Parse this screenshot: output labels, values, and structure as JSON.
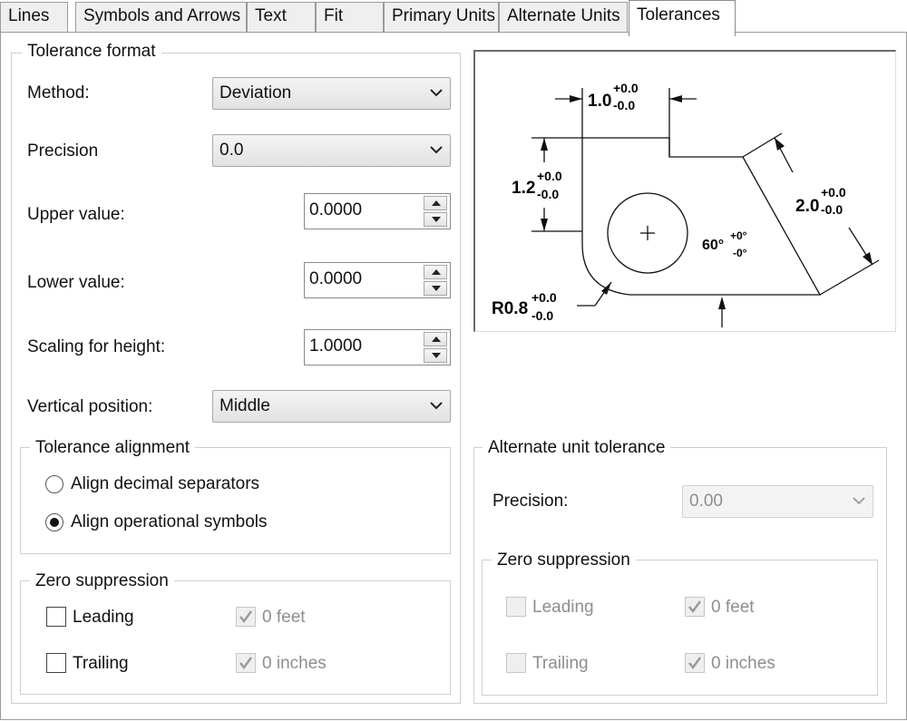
{
  "tabs": [
    {
      "label": "Lines"
    },
    {
      "label": "Symbols and Arrows"
    },
    {
      "label": "Text"
    },
    {
      "label": "Fit"
    },
    {
      "label": "Primary Units"
    },
    {
      "label": "Alternate Units"
    },
    {
      "label": "Tolerances",
      "active": true
    }
  ],
  "tolerance_format": {
    "title": "Tolerance format",
    "method_label": "Method:",
    "method_value": "Deviation",
    "precision_label": "Precision",
    "precision_value": "0.0",
    "upper_label": "Upper value:",
    "upper_value": "0.0000",
    "lower_label": "Lower value:",
    "lower_value": "0.0000",
    "scaling_label": "Scaling for height:",
    "scaling_value": "1.0000",
    "vertical_label": "Vertical position:",
    "vertical_value": "Middle"
  },
  "alignment": {
    "title": "Tolerance alignment",
    "option1": "Align decimal separators",
    "option2": "Align operational symbols",
    "selected": "option2"
  },
  "zero_suppression": {
    "title": "Zero suppression",
    "leading": "Leading",
    "trailing": "Trailing",
    "feet": "0 feet",
    "inches": "0 inches",
    "leading_checked": false,
    "trailing_checked": false,
    "feet_checked": true,
    "inches_checked": true
  },
  "alternate": {
    "title": "Alternate unit tolerance",
    "precision_label": "Precision:",
    "precision_value": "0.00",
    "zero_title": "Zero suppression",
    "leading": "Leading",
    "trailing": "Trailing",
    "feet": "0 feet",
    "inches": "0 inches",
    "feet_checked": true,
    "inches_checked": true
  },
  "preview": {
    "dim_top": "1.0",
    "dim_left": "1.2",
    "dim_right": "2.0",
    "dim_radius": "R0.8",
    "dim_angle": "60°",
    "tol_plus": "+0.0",
    "tol_minus": "-0.0",
    "angle_plus": "+0°",
    "angle_minus": "-0°"
  },
  "colors": {
    "tab_inactive": "#efefef",
    "border": "#9a9a9a",
    "disabled_text": "#8e8e8e"
  }
}
